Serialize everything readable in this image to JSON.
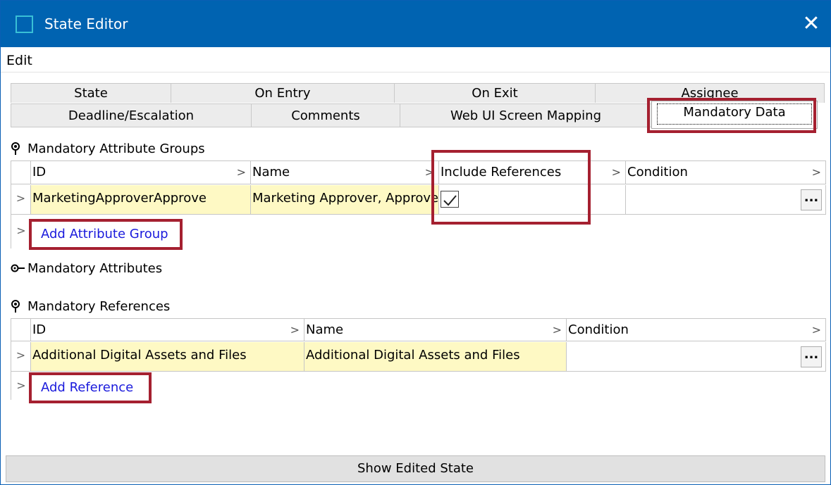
{
  "window": {
    "title": "State Editor",
    "close_glyph": "✕",
    "icon": "window-icon"
  },
  "menu": {
    "items": [
      {
        "label": "Edit"
      }
    ]
  },
  "tabs": {
    "row1": [
      {
        "label": "State"
      },
      {
        "label": "On Entry"
      },
      {
        "label": "On Exit"
      },
      {
        "label": "Assignee"
      }
    ],
    "row2": [
      {
        "label": "Deadline/Escalation"
      },
      {
        "label": "Comments"
      },
      {
        "label": "Web UI Screen Mapping"
      },
      {
        "label": "Mandatory Data",
        "active": true
      }
    ]
  },
  "attr_groups": {
    "title": "Mandatory Attribute Groups",
    "columns": [
      "ID",
      "Name",
      "Include References",
      "Condition"
    ],
    "rows": [
      {
        "id": "MarketingApproverApprove",
        "name": "Marketing Approver, Approve",
        "include_references": true,
        "condition": ""
      }
    ],
    "add_label": "Add Attribute Group",
    "ellipsis": "..."
  },
  "attributes": {
    "title": "Mandatory Attributes"
  },
  "references": {
    "title": "Mandatory References",
    "columns": [
      "ID",
      "Name",
      "Condition"
    ],
    "rows": [
      {
        "id": "Additional Digital Assets and Files",
        "name": "Additional Digital Assets and Files",
        "condition": ""
      }
    ],
    "add_label": "Add Reference",
    "ellipsis": "..."
  },
  "footer": {
    "show_edited_label": "Show Edited State"
  },
  "row_glyph": ">",
  "colors": {
    "titlebar": "#0063b1",
    "highlight_box": "#a52030",
    "row_yellow": "#fef9c4",
    "link": "#1a1adc"
  }
}
